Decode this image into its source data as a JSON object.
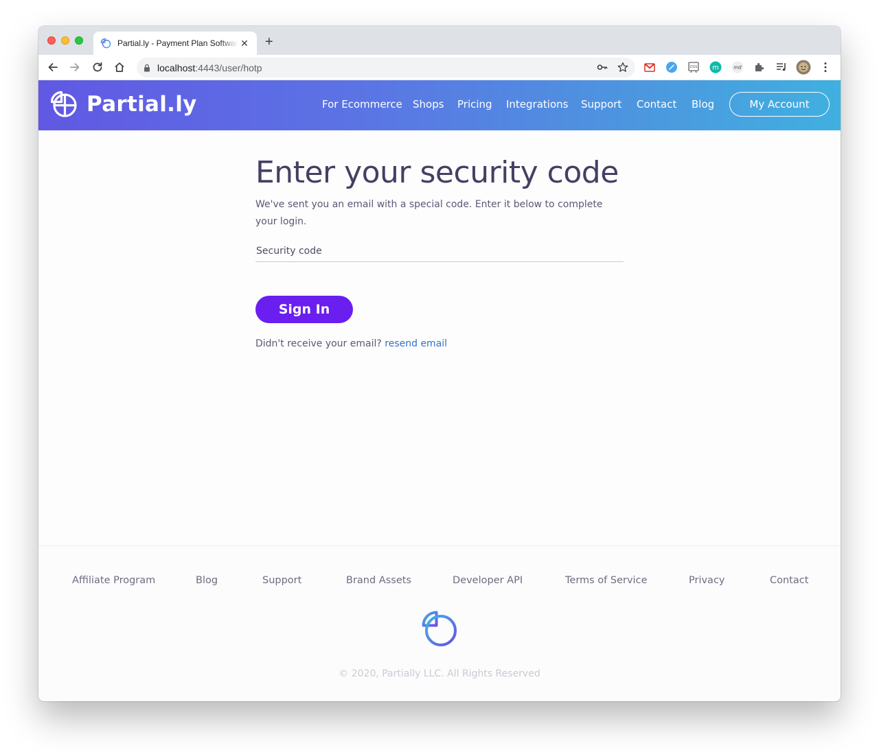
{
  "browser": {
    "tab_title": "Partial.ly - Payment Plan Software",
    "url_host": "localhost",
    "url_rest": ":4443/user/hotp"
  },
  "header": {
    "brand": "Partial.ly",
    "nav": [
      "For Ecommerce",
      "Shops",
      "Pricing",
      "Integrations",
      "Support",
      "Contact",
      "Blog"
    ],
    "account_label": "My Account"
  },
  "main": {
    "title": "Enter your security code",
    "description": "We've sent you an email with a special code. Enter it below to complete your login.",
    "input_placeholder": "Security code",
    "signin_label": "Sign In",
    "resend_prompt": "Didn't receive your email?",
    "resend_link": "resend email"
  },
  "footer": {
    "links": [
      "Affiliate Program",
      "Blog",
      "Support",
      "Brand Assets",
      "Developer API",
      "Terms of Service",
      "Privacy",
      "Contact"
    ],
    "copyright": "© 2020, Partially LLC. All Rights Reserved"
  },
  "colors": {
    "header_gradient_start": "#6158e3",
    "header_gradient_end": "#40b0e0",
    "primary_button": "#6a1ef0",
    "link": "#2f72c9",
    "title_text": "#444063"
  }
}
